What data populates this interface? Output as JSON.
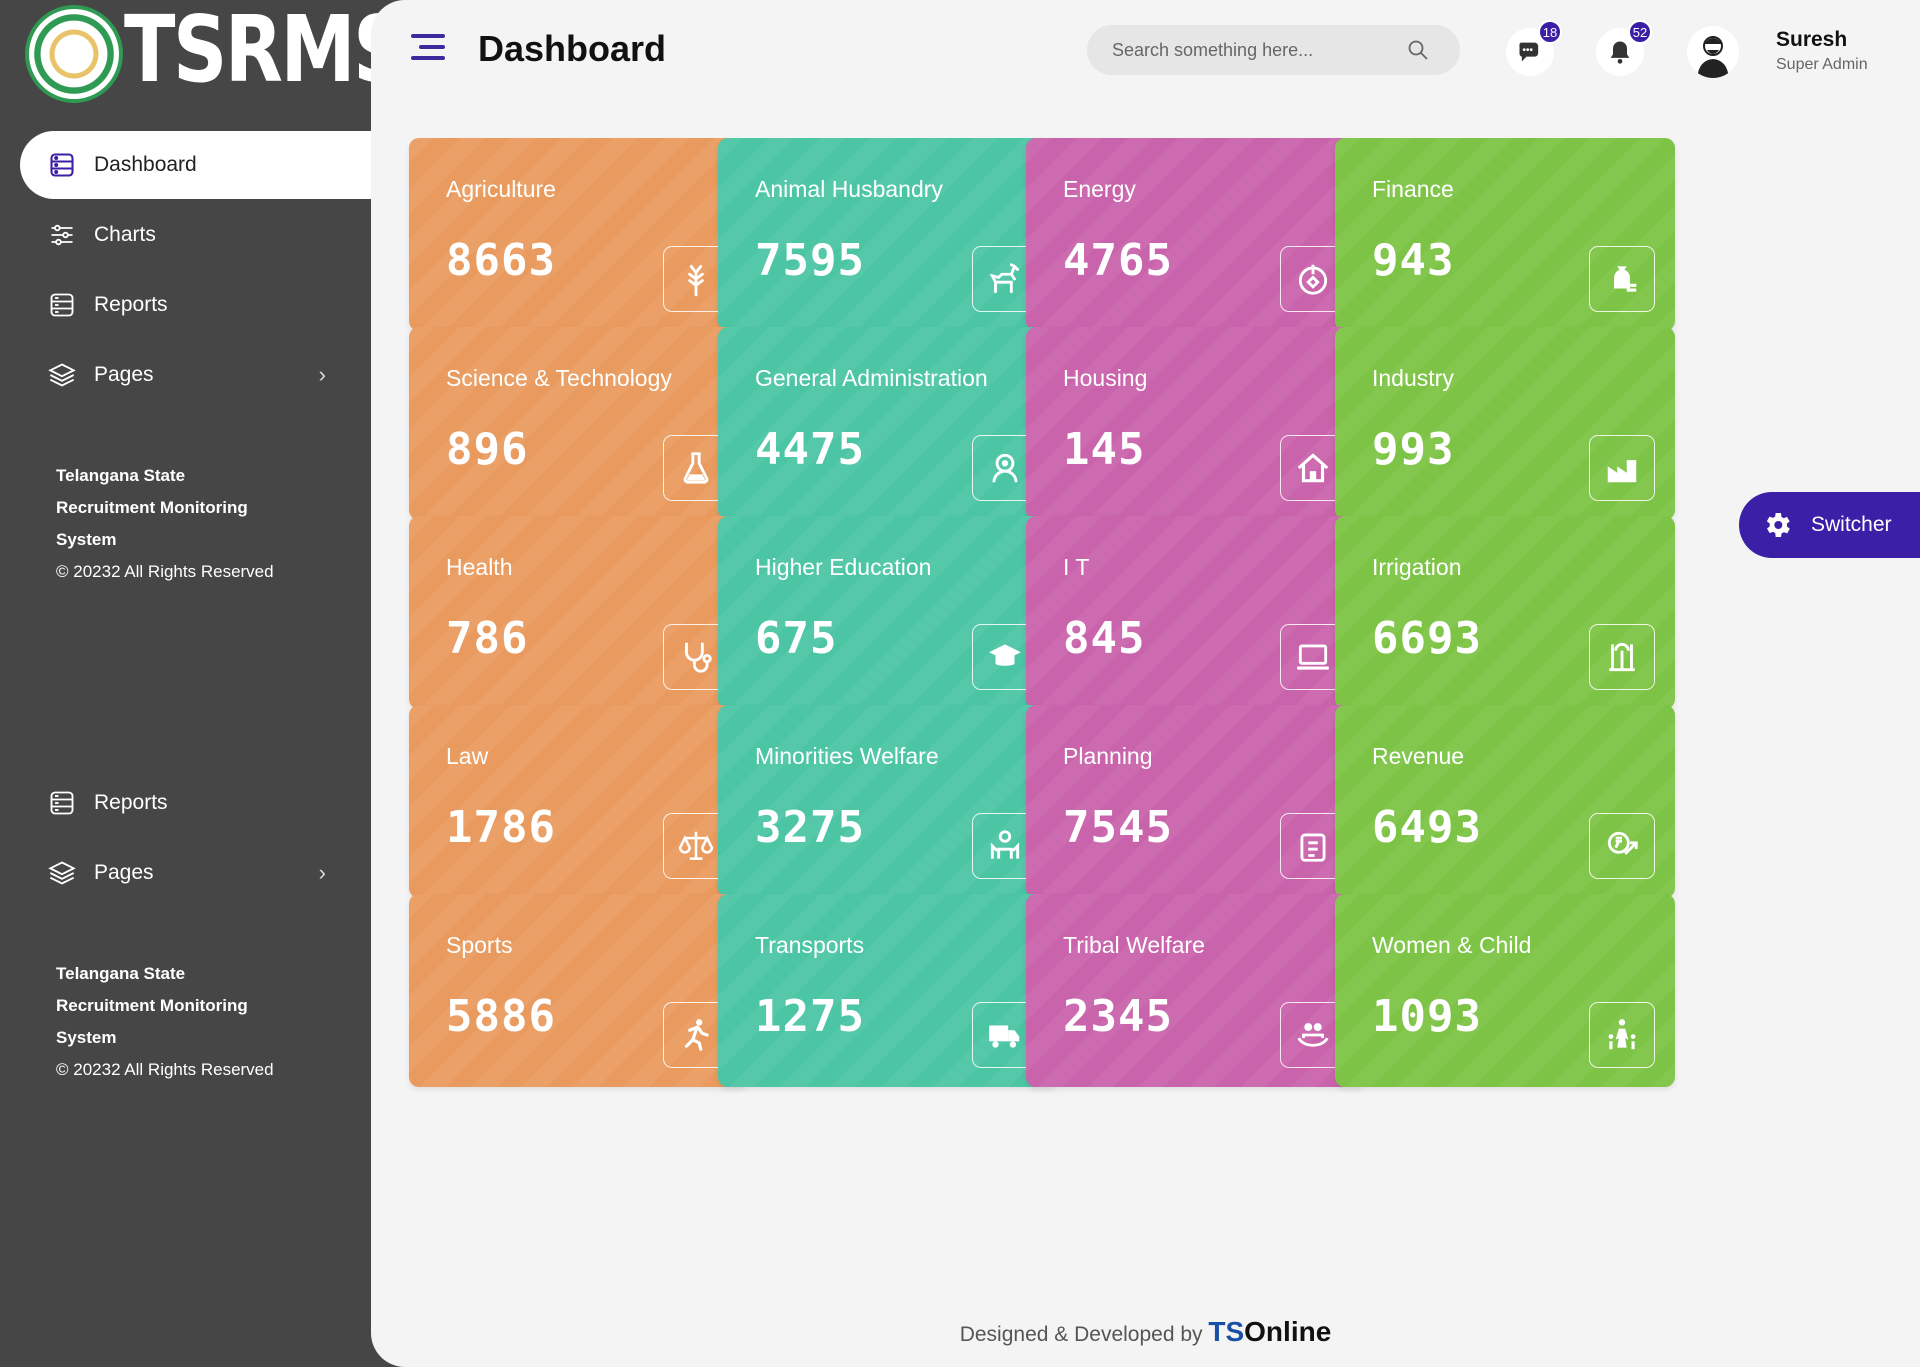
{
  "app": {
    "logo_text": "TSRMS"
  },
  "sidebar": {
    "nav": [
      {
        "label": "Dashboard",
        "icon": "dashboard-icon",
        "active": true
      },
      {
        "label": "Charts",
        "icon": "sliders-icon"
      },
      {
        "label": "Reports",
        "icon": "reports-icon"
      },
      {
        "label": "Pages",
        "icon": "layers-icon",
        "has_submenu": true
      }
    ],
    "nav_secondary": [
      {
        "label": "Reports",
        "icon": "reports-icon"
      },
      {
        "label": "Pages",
        "icon": "layers-icon",
        "has_submenu": true
      }
    ],
    "footer": {
      "org_line1": "Telangana State",
      "org_line2": "Recruitment Monitoring",
      "org_line3": "System",
      "copyright": "© 20232 All Rights Reserved"
    }
  },
  "header": {
    "title": "Dashboard",
    "search_placeholder": "Search something here...",
    "messages_count": "18",
    "notifications_count": "52",
    "user_name": "Suresh",
    "user_role": "Super Admin"
  },
  "cards": [
    {
      "title": "Agriculture",
      "value": "8663",
      "color": "#e99b5f",
      "icon": "wheat-icon"
    },
    {
      "title": "Animal Husbandry",
      "value": "7595",
      "color": "#4cc5a5",
      "icon": "deer-icon"
    },
    {
      "title": "Energy",
      "value": "4765",
      "color": "#c963ab",
      "icon": "energy-icon"
    },
    {
      "title": "Finance",
      "value": "943",
      "color": "#7dc446",
      "icon": "money-bag-icon"
    },
    {
      "title": "Science & Technology",
      "value": "896",
      "color": "#e99b5f",
      "icon": "flask-icon"
    },
    {
      "title": "General Administration",
      "value": "4475",
      "color": "#4cc5a5",
      "icon": "admin-gear-icon"
    },
    {
      "title": "Housing",
      "value": "145",
      "color": "#c963ab",
      "icon": "house-icon"
    },
    {
      "title": "Industry",
      "value": "993",
      "color": "#7dc446",
      "icon": "industry-icon"
    },
    {
      "title": "Health",
      "value": "786",
      "color": "#e99b5f",
      "icon": "stethoscope-icon"
    },
    {
      "title": "Higher Education",
      "value": "675",
      "color": "#4cc5a5",
      "icon": "graduation-cap-icon"
    },
    {
      "title": "I T",
      "value": "845",
      "color": "#c963ab",
      "icon": "laptop-icon"
    },
    {
      "title": "Irrigation",
      "value": "6693",
      "color": "#7dc446",
      "icon": "irrigation-icon"
    },
    {
      "title": "Law",
      "value": "1786",
      "color": "#e99b5f",
      "icon": "scales-icon"
    },
    {
      "title": "Minorities Welfare",
      "value": "3275",
      "color": "#4cc5a5",
      "icon": "raised-hands-icon"
    },
    {
      "title": "Planning",
      "value": "7545",
      "color": "#c963ab",
      "icon": "clipboard-icon"
    },
    {
      "title": "Revenue",
      "value": "6493",
      "color": "#7dc446",
      "icon": "rupee-growth-icon"
    },
    {
      "title": "Sports",
      "value": "5886",
      "color": "#e99b5f",
      "icon": "runner-icon"
    },
    {
      "title": "Transports",
      "value": "1275",
      "color": "#4cc5a5",
      "icon": "truck-icon"
    },
    {
      "title": "Tribal Welfare",
      "value": "2345",
      "color": "#c963ab",
      "icon": "people-care-icon"
    },
    {
      "title": "Women & Child",
      "value": "1093",
      "color": "#7dc446",
      "icon": "family-icon"
    }
  ],
  "switcher": {
    "label": "Switcher"
  },
  "footer": {
    "prefix": "Designed & Developed by",
    "brand_ts": "TS",
    "brand_rest": "Online"
  }
}
